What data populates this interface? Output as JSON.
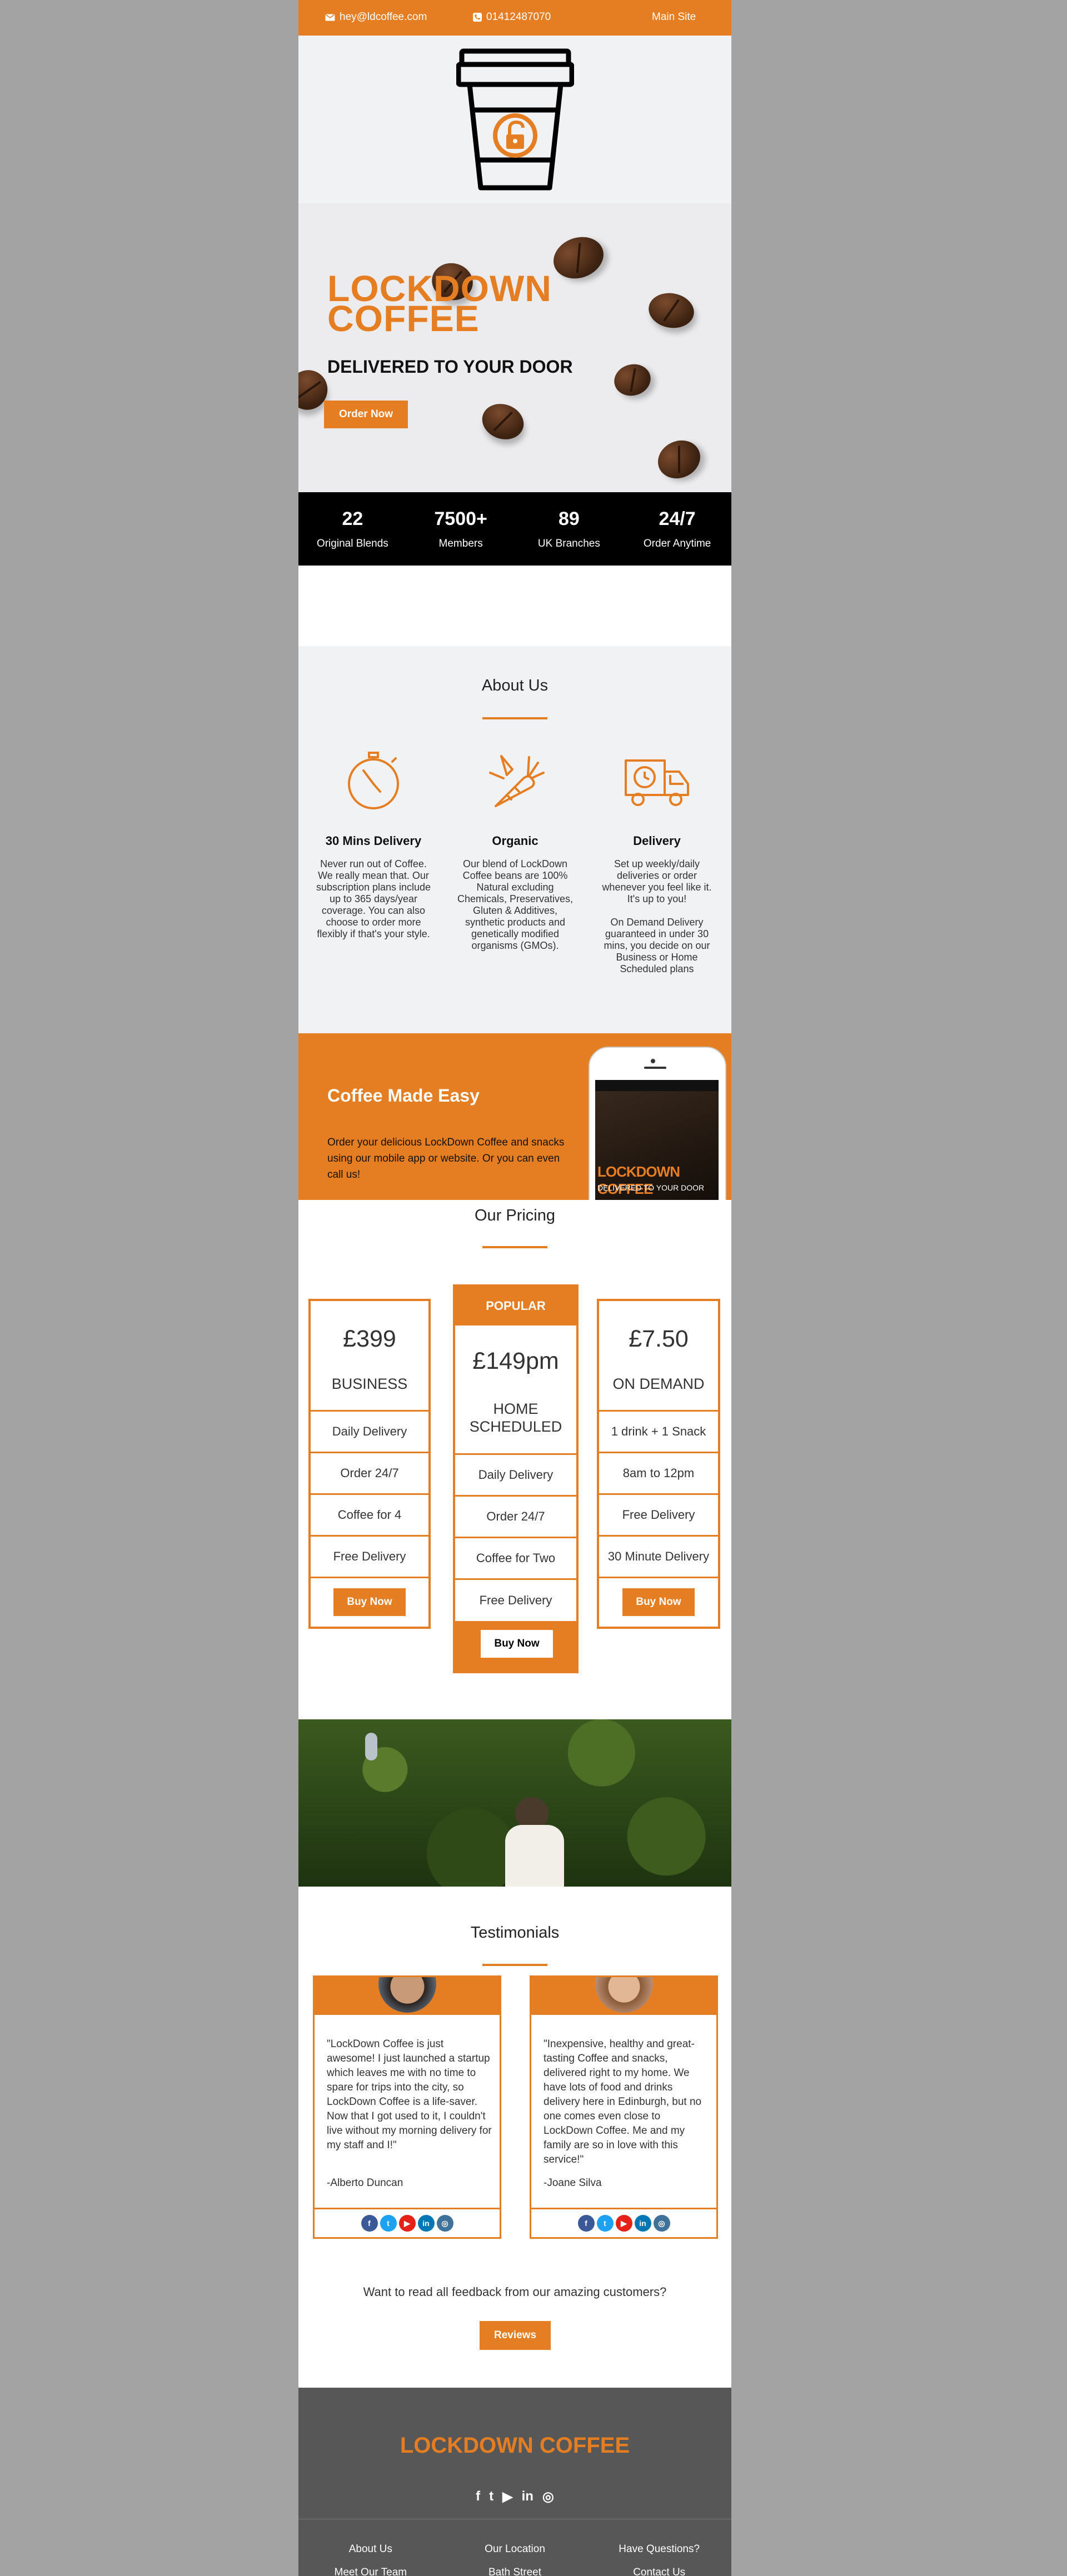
{
  "topbar": {
    "email": "hey@ldcoffee.com",
    "phone": "01412487070",
    "main_site": "Main Site"
  },
  "hero": {
    "title_line1": "LOCKDOWN",
    "title_line2": "COFFEE",
    "subtitle": "DELIVERED TO YOUR DOOR",
    "cta": "Order Now"
  },
  "stats": [
    {
      "value": "22",
      "label": "Original Blends"
    },
    {
      "value": "7500+",
      "label": "Members"
    },
    {
      "value": "89",
      "label": "UK Branches"
    },
    {
      "value": "24/7",
      "label": "Order Anytime"
    }
  ],
  "about": {
    "title": "About Us",
    "features": [
      {
        "icon": "stopwatch-icon",
        "title": "30 Mins Delivery",
        "text": "Never run out of Coffee. We really mean that. Our subscription plans include up to 365 days/year coverage. You can also choose to order more flexibly if that's your style."
      },
      {
        "icon": "organic-carrot-icon",
        "title": "Organic",
        "text": "Our blend of LockDown Coffee beans are 100% Natural excluding Chemicals, Preservatives, Gluten & Additives, synthetic products and genetically modified organisms (GMOs)."
      },
      {
        "icon": "delivery-truck-icon",
        "title": "Delivery",
        "text": "Set up weekly/daily deliveries or order whenever you feel like it. It's up to you!",
        "text2": "On Demand Delivery guaranteed in under 30 mins, you decide on our Business or Home Scheduled plans"
      }
    ]
  },
  "easy": {
    "title": "Coffee Made Easy",
    "text": "Order your delicious LockDown Coffee and snacks using our mobile app or website. Or you can even call us!",
    "phone_screen_title": "LOCKDOWN COFFEE",
    "phone_screen_sub": "DELIVERED TO YOUR DOOR"
  },
  "pricing": {
    "title": "Our Pricing",
    "popular_label": "POPULAR",
    "plans": [
      {
        "price": "£399",
        "name": "BUSINESS",
        "features": [
          "Daily Delivery",
          "Order 24/7",
          "Coffee for 4",
          "Free Delivery"
        ],
        "cta": "Buy Now"
      },
      {
        "price": "£149pm",
        "name": "HOME SCHEDULED",
        "features": [
          "Daily Delivery",
          "Order 24/7",
          "Coffee for Two",
          "Free Delivery"
        ],
        "cta": "Buy Now"
      },
      {
        "price": "£7.50",
        "name": "ON DEMAND",
        "features": [
          "1 drink + 1 Snack",
          "8am to 12pm",
          "Free Delivery",
          "30 Minute Delivery"
        ],
        "cta": "Buy Now"
      }
    ]
  },
  "testimonials": {
    "title": "Testimonials",
    "items": [
      {
        "quote": "\"LockDown Coffee is just awesome! I just launched a startup which leaves me with no time to spare for trips into the city, so LockDown Coffee is a life-saver. Now that I got used to it, I couldn't live without my morning delivery for my staff and I!\"",
        "author": "-Alberto Duncan"
      },
      {
        "quote": "\"Inexpensive, healthy and great-tasting Coffee and snacks, delivered right to my home. We have lots of food and drinks delivery here in Edinburgh, but no one comes even close to LockDown Coffee. Me and my family are so in love with this service!\"",
        "author": "-Joane Silva"
      }
    ],
    "social": [
      "f",
      "t",
      "▶",
      "in",
      "◎"
    ],
    "more_text": "Want to read all feedback from our amazing customers?",
    "reviews_cta": "Reviews"
  },
  "footer": {
    "brand": "LOCKDOWN COFFEE",
    "col1": [
      "About Us",
      "Meet Our Team"
    ],
    "col2": [
      "Our Location",
      "Bath Street"
    ],
    "col3": [
      "Have Questions?",
      "Contact Us"
    ]
  },
  "colors": {
    "accent": "#e57e22",
    "dark": "#000000",
    "footer": "#575757",
    "page_bg": "#a3a3a3"
  }
}
